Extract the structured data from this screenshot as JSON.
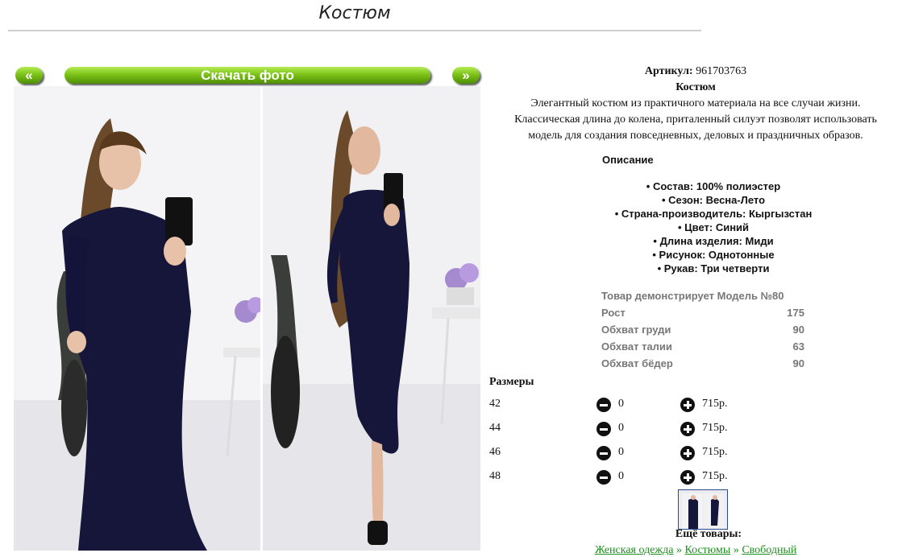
{
  "page": {
    "title": "Костюм"
  },
  "gallery": {
    "prev_label": "«",
    "download_label": "Скачать фото",
    "next_label": "»"
  },
  "product": {
    "article_label": "Артикул:",
    "article_value": "961703763",
    "name": "Костюм",
    "description_lines": [
      "Элегантный костюм из практичного материала на все случаи жизни.",
      "Классическая длина до колена, приталенный силуэт позволят использовать",
      "модель для создания повседневных, деловых и праздничных образов."
    ]
  },
  "description": {
    "heading": "Описание",
    "items": [
      "• Состав: 100% полиэстер",
      "• Сезон: Весна-Лето",
      "• Страна-производитель: Кыргызстан",
      "• Цвет: Синий",
      "• Длина изделия: Миди",
      "• Рисунок: Однотонные",
      "• Рукав: Три четверти"
    ]
  },
  "model": {
    "rows": [
      {
        "label": "Товар демонстрирует Модель №80",
        "value": ""
      },
      {
        "label": "Рост",
        "value": "175"
      },
      {
        "label": "Обхват груди",
        "value": "90"
      },
      {
        "label": "Обхват талии",
        "value": "63"
      },
      {
        "label": "Обхват бёдер",
        "value": "90"
      }
    ]
  },
  "sizes": {
    "heading": "Размеры",
    "rows": [
      {
        "size": "42",
        "qty": "0",
        "price": "715р."
      },
      {
        "size": "44",
        "qty": "0",
        "price": "715р."
      },
      {
        "size": "46",
        "qty": "0",
        "price": "715р."
      },
      {
        "size": "48",
        "qty": "0",
        "price": "715р."
      }
    ]
  },
  "more": {
    "heading": "Ещё товары:",
    "links": [
      "Женская одежда",
      "Костюмы",
      "Свободный"
    ],
    "separator": " » "
  },
  "colors": {
    "button_green": "#7cc318",
    "dress": "#16163a",
    "link_green": "#1a8f1a"
  }
}
